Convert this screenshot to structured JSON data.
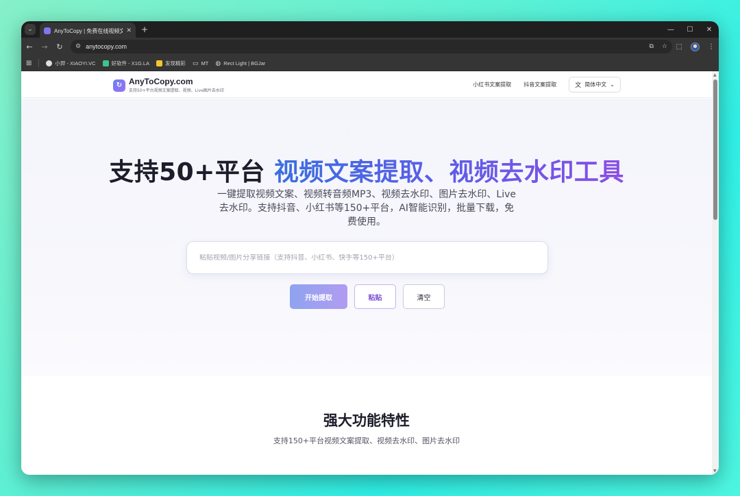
{
  "browser": {
    "tab_title": "AnyToCopy | 免费在线视频文案",
    "url": "anytocopy.com",
    "bookmarks": [
      {
        "label": "小羿 - XIAOYI.VC",
        "color": "#dedede"
      },
      {
        "label": "好软件 - X1G.LA",
        "color": "#3cc48a"
      },
      {
        "label": "发现精彩",
        "color": "#f4c430"
      },
      {
        "label": "MT",
        "color": "#cfcfcf"
      },
      {
        "label": "Rect Light | BGJar",
        "color": "#cfcfcf"
      }
    ]
  },
  "site": {
    "logo_name": "AnyToCopy.com",
    "logo_sub": "支持50+平台视频文案提取、视频、Live图片去水印",
    "nav": [
      "小红书文案提取",
      "抖音文案提取"
    ],
    "language": "简体中文"
  },
  "hero": {
    "title_plain": "支持50+平台 ",
    "title_highlight": "视频文案提取、视频去水印工具",
    "description": "一键提取视频文案、视频转音频MP3、视频去水印、图片去水印、Live去水印。支持抖音、小红书等150+平台，AI智能识别，批量下载，免费使用。",
    "search_placeholder": "粘贴视频/图片分享链接（支持抖音、小红书、快手等150+平台）",
    "btn_extract": "开始提取",
    "btn_paste": "粘贴",
    "btn_clear": "清空"
  },
  "features": {
    "title": "强大功能特性",
    "subtitle": "支持150+平台视频文案提取、视频去水印、图片去水印"
  }
}
